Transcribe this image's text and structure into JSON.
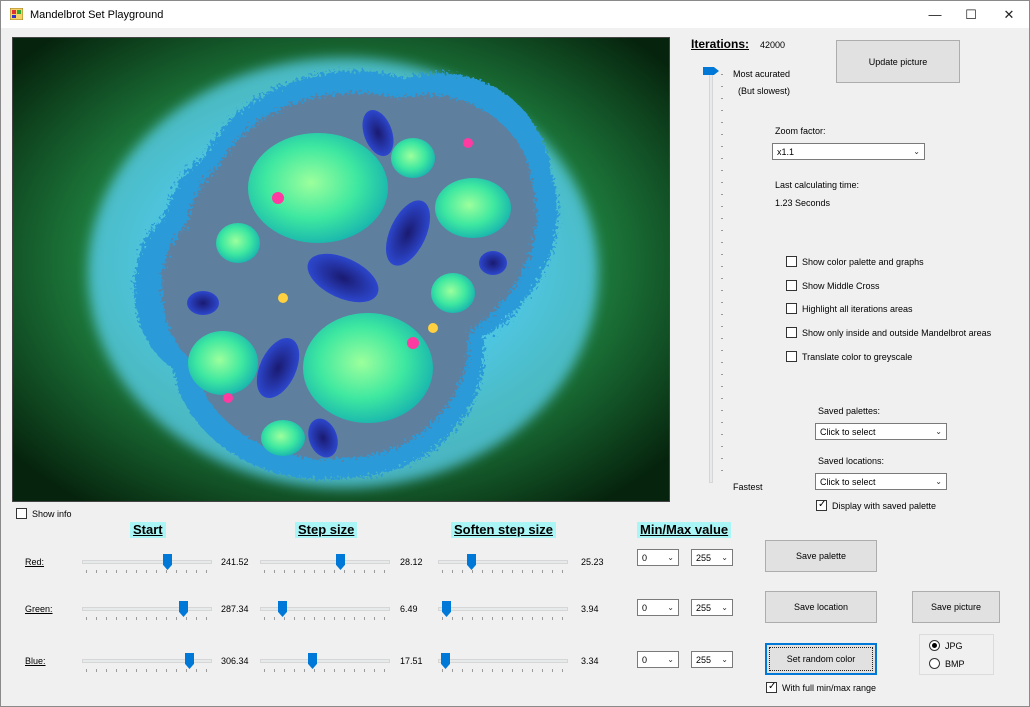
{
  "window": {
    "title": "Mandelbrot Set Playground",
    "minimize": "—",
    "maximize": "☐",
    "close": "✕",
    "app_icon": "palette-app-icon"
  },
  "iterations": {
    "label": "Iterations:",
    "value": "42000",
    "slider_top_label": "Most acurated",
    "slider_top_sublabel": "(But slowest)",
    "slider_bottom_label": "Fastest"
  },
  "update_button": "Update picture",
  "zoom": {
    "label": "Zoom factor:",
    "value": "x1.1"
  },
  "calc_time": {
    "label": "Last calculating time:",
    "value": "1.23 Seconds"
  },
  "options": [
    {
      "label": "Show color palette and graphs",
      "checked": false
    },
    {
      "label": "Show Middle Cross",
      "checked": false
    },
    {
      "label": "Highlight all iterations areas",
      "checked": false
    },
    {
      "label": "Show only inside and outside Mandelbrot areas",
      "checked": false
    },
    {
      "label": "Translate color to greyscale",
      "checked": false
    }
  ],
  "saved_palettes": {
    "label": "Saved palettes:",
    "value": "Click to select"
  },
  "saved_locations": {
    "label": "Saved locations:",
    "value": "Click to select"
  },
  "display_saved_palette": {
    "label": "Display with saved palette",
    "checked": true
  },
  "show_info": {
    "label": "Show info",
    "checked": false
  },
  "headers": {
    "start": "Start",
    "step": "Step size",
    "soften": "Soften step size",
    "minmax": "Min/Max value"
  },
  "rows": [
    {
      "label": "Red:",
      "start": "241.52",
      "step": "28.12",
      "soften": "25.23",
      "min": "0",
      "max": "255"
    },
    {
      "label": "Green:",
      "start": "287.34",
      "step": "6.49",
      "soften": "3.94",
      "min": "0",
      "max": "255"
    },
    {
      "label": "Blue:",
      "start": "306.34",
      "step": "17.51",
      "soften": "3.34",
      "min": "0",
      "max": "255"
    }
  ],
  "buttons": {
    "save_palette": "Save  palette",
    "save_location": "Save location",
    "save_picture": "Save picture",
    "random_color": "Set random color"
  },
  "full_range": {
    "label": "With full min/max range",
    "checked": true
  },
  "format": {
    "options": [
      "JPG",
      "BMP"
    ],
    "selected": "JPG"
  },
  "colors": {
    "accent": "#0078d7",
    "header_highlight": "#aaf6f6"
  }
}
